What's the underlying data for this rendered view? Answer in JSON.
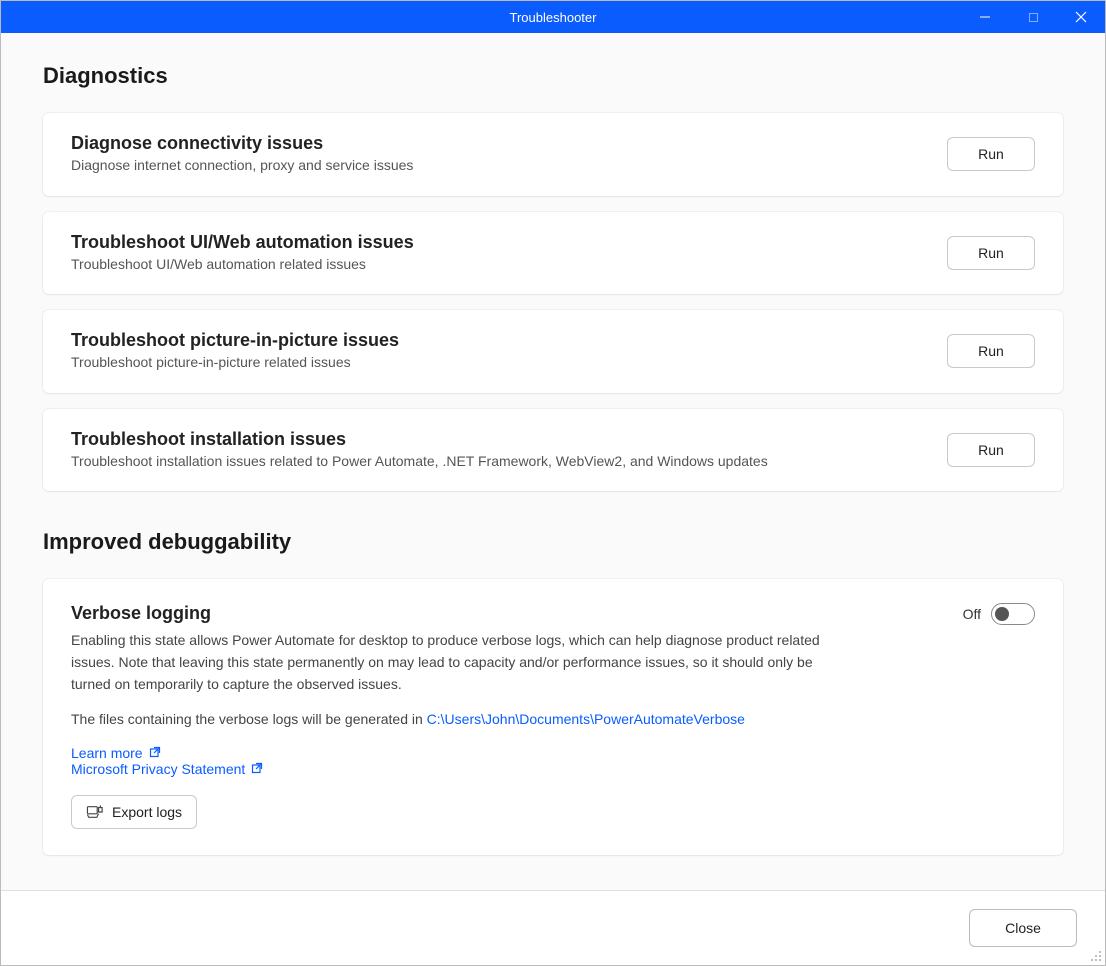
{
  "window": {
    "title": "Troubleshooter"
  },
  "sections": {
    "diagnostics_title": "Diagnostics",
    "improved_title": "Improved debuggability"
  },
  "diagnostics": [
    {
      "title": "Diagnose connectivity issues",
      "desc": "Diagnose internet connection, proxy and service issues",
      "button": "Run"
    },
    {
      "title": "Troubleshoot UI/Web automation issues",
      "desc": "Troubleshoot UI/Web automation related issues",
      "button": "Run"
    },
    {
      "title": "Troubleshoot picture-in-picture issues",
      "desc": "Troubleshoot picture-in-picture related issues",
      "button": "Run"
    },
    {
      "title": "Troubleshoot installation issues",
      "desc": "Troubleshoot installation issues related to Power Automate, .NET Framework, WebView2, and Windows updates",
      "button": "Run"
    }
  ],
  "verbose": {
    "title": "Verbose logging",
    "desc1": "Enabling this state allows Power Automate for desktop to produce verbose logs, which can help diagnose product related issues. Note that leaving this state permanently on may lead to capacity and/or performance issues, so it should only be turned on temporarily to capture the observed issues.",
    "desc2_prefix": "The files containing the verbose logs will be generated in ",
    "log_path": "C:\\Users\\John\\Documents\\PowerAutomateVerbose",
    "toggle_state": "Off",
    "learn_more": "Learn more",
    "privacy": "Microsoft Privacy Statement",
    "export": "Export logs"
  },
  "footer": {
    "close": "Close"
  }
}
